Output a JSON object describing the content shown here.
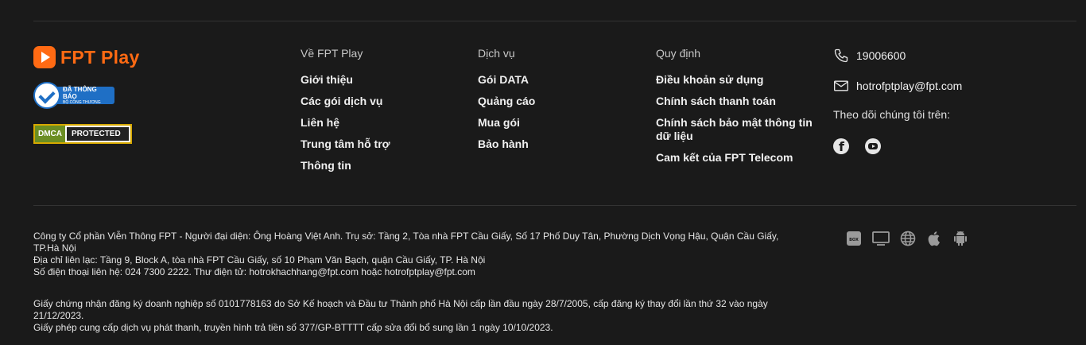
{
  "brand": {
    "logo_text": "FPT Play",
    "bct_badge_line1": "ĐÃ THÔNG BÁO",
    "bct_badge_line2": "BỘ CÔNG THƯƠNG",
    "dmca_left": "DMCA",
    "dmca_right": "PROTECTED",
    "accent_color": "#ff6a13"
  },
  "columns": [
    {
      "title": "Về FPT Play",
      "links": [
        "Giới thiệu",
        "Các gói dịch vụ",
        "Liên hệ",
        "Trung tâm hỗ trợ",
        "Thông tin"
      ]
    },
    {
      "title": "Dịch vụ",
      "links": [
        "Gói DATA",
        "Quảng cáo",
        "Mua gói",
        "Bảo hành"
      ]
    },
    {
      "title": "Quy định",
      "links": [
        "Điều khoản sử dụng",
        "Chính sách thanh toán",
        "Chính sách bảo mật thông tin dữ liệu",
        "Cam kết của FPT Telecom"
      ]
    }
  ],
  "contact": {
    "phone": "19006600",
    "email": "hotrofptplay@fpt.com",
    "follow_label": "Theo dõi chúng tôi trên:",
    "social_icons": [
      "facebook-icon",
      "youtube-icon"
    ]
  },
  "legal": {
    "company": "Công ty Cổ phần Viễn Thông FPT - Người đại diện: Ông Hoàng Việt Anh. Trụ sở: Tầng 2, Tòa nhà FPT Cầu Giấy, Số 17 Phố Duy Tân, Phường Dịch Vọng Hậu, Quận Cầu Giấy, TP.Hà Nội",
    "address": "Địa chỉ liên lạc: Tầng 9, Block A, tòa nhà FPT Cầu Giấy, số 10 Phạm Văn Bạch, quận Cầu Giấy, TP. Hà Nội",
    "phone_email": "Số điện thoại liên hệ: 024 7300 2222. Thư điện tử: hotrokhachhang@fpt.com hoặc hotrofptplay@fpt.com",
    "license1": "Giấy chứng nhận đăng ký doanh nghiệp số 0101778163 do Sở Kế hoạch và Đầu tư Thành phố Hà Nội cấp lần đầu ngày 28/7/2005, cấp đăng ký thay đổi lần thứ 32 vào ngày 21/12/2023.",
    "license2": "Giấy phép cung cấp dịch vụ phát thanh, truyền hình trả tiền số 377/GP-BTTTT cấp sửa đổi bổ sung lần 1 ngày 10/10/2023."
  },
  "platforms": {
    "box_label": "BOX",
    "icons": [
      "box-icon",
      "tv-icon",
      "web-icon",
      "apple-icon",
      "android-icon"
    ]
  }
}
